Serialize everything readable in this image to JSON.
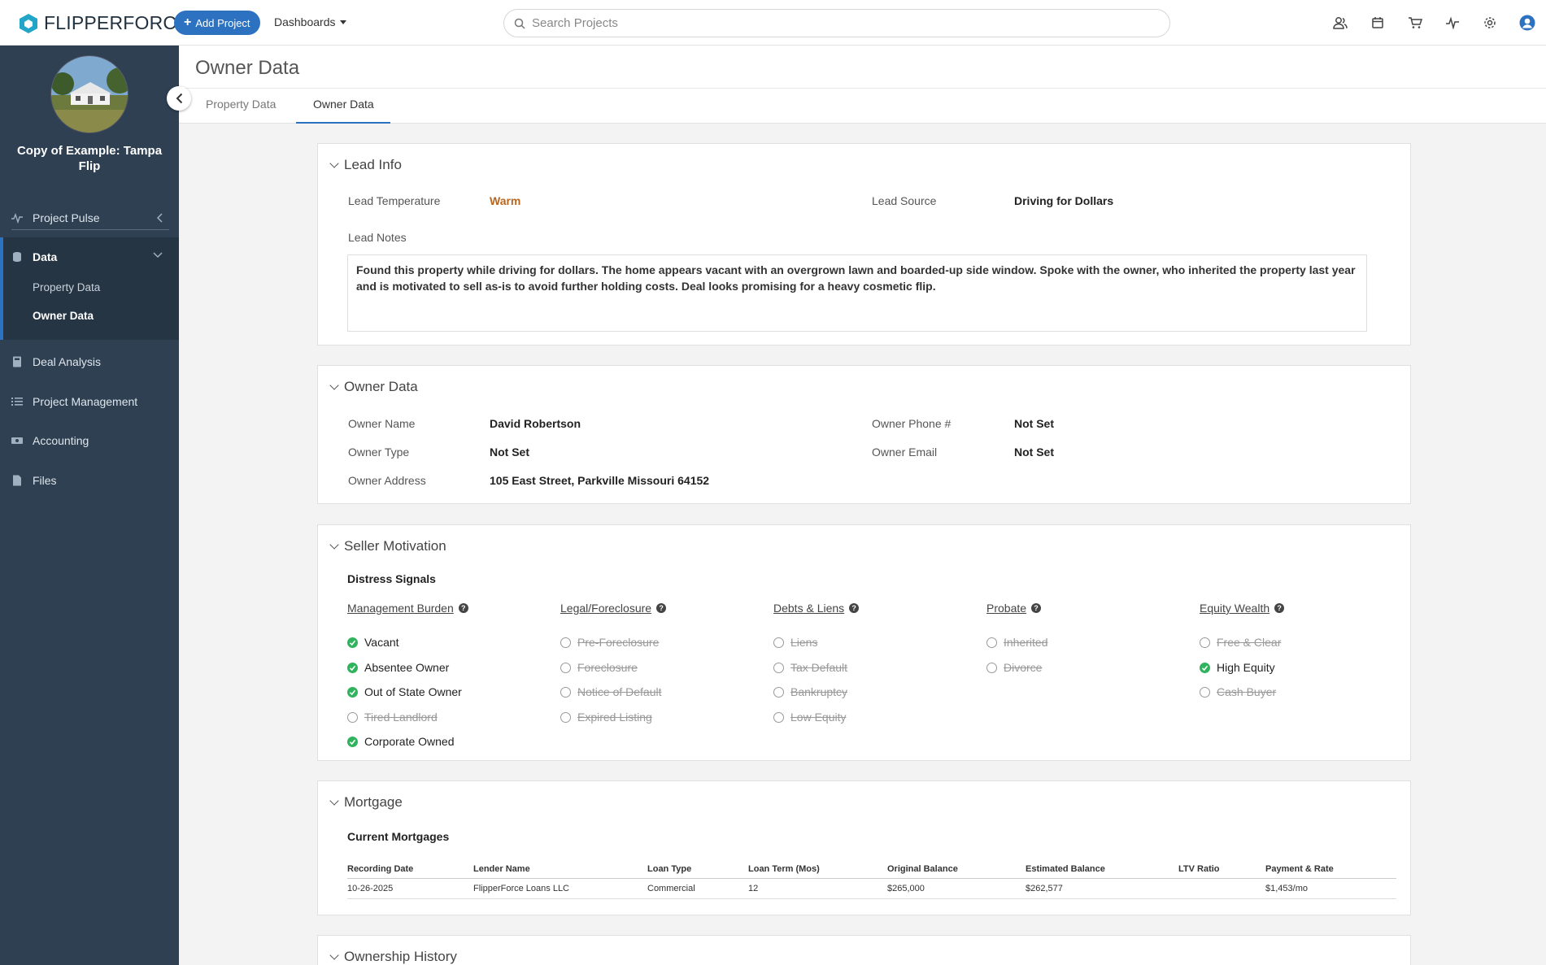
{
  "app": {
    "brand": "FLIPPERFORCE",
    "add_project": "Add Project",
    "dashboards": "Dashboards",
    "search_placeholder": "Search Projects",
    "top_icons": [
      "users-icon",
      "calendar-icon",
      "cart-icon",
      "pulse-icon",
      "settings-icon",
      "profile-avatar-icon"
    ]
  },
  "sidebar": {
    "project_name": "Copy of Example: Tampa Flip",
    "project_pulse": "Project Pulse",
    "data": "Data",
    "property_data": "Property Data",
    "owner_data": "Owner Data",
    "deal_analysis": "Deal Analysis",
    "project_management": "Project Management",
    "accounting": "Accounting",
    "files": "Files"
  },
  "header": {
    "title": "Owner Data",
    "tabs": [
      "Property Data",
      "Owner Data"
    ]
  },
  "lead_info": {
    "title": "Lead Info",
    "temp_label": "Lead Temperature",
    "temp_value": "Warm",
    "source_label": "Lead Source",
    "source_value": "Driving for Dollars",
    "notes_label": "Lead Notes",
    "notes": "Found this property while driving for dollars. The home appears vacant with an overgrown lawn and boarded-up side window. Spoke with the owner, who inherited the property last year and is motivated to sell as-is to avoid further holding costs. Deal looks promising for a heavy cosmetic flip."
  },
  "owner": {
    "title": "Owner Data",
    "name_label": "Owner Name",
    "name_value": "David Robertson",
    "type_label": "Owner Type",
    "type_value": "Not Set",
    "address_label": "Owner Address",
    "address_value": "105 East Street, Parkville Missouri 64152",
    "phone_label": "Owner Phone #",
    "phone_value": "Not Set",
    "email_label": "Owner Email",
    "email_value": "Not Set"
  },
  "seller": {
    "title": "Seller Motivation",
    "subhead": "Distress Signals",
    "categories": [
      {
        "name": "Management Burden",
        "signals": [
          {
            "label": "Vacant",
            "on": true
          },
          {
            "label": "Absentee Owner",
            "on": true
          },
          {
            "label": "Out of State Owner",
            "on": true
          },
          {
            "label": "Tired Landlord",
            "on": false
          },
          {
            "label": "Corporate Owned",
            "on": true
          }
        ]
      },
      {
        "name": "Legal/Foreclosure",
        "signals": [
          {
            "label": "Pre-Foreclosure",
            "on": false
          },
          {
            "label": "Foreclosure",
            "on": false
          },
          {
            "label": "Notice of Default",
            "on": false
          },
          {
            "label": "Expired Listing",
            "on": false
          }
        ]
      },
      {
        "name": "Debts & Liens",
        "signals": [
          {
            "label": "Liens",
            "on": false
          },
          {
            "label": "Tax Default",
            "on": false
          },
          {
            "label": "Bankruptcy",
            "on": false
          },
          {
            "label": "Low Equity",
            "on": false
          }
        ]
      },
      {
        "name": "Probate",
        "signals": [
          {
            "label": "Inherited",
            "on": false
          },
          {
            "label": "Divorce",
            "on": false
          }
        ]
      },
      {
        "name": "Equity Wealth",
        "signals": [
          {
            "label": "Free & Clear",
            "on": false
          },
          {
            "label": "High Equity",
            "on": true
          },
          {
            "label": "Cash Buyer",
            "on": false
          }
        ]
      }
    ]
  },
  "mortgage": {
    "title": "Mortgage",
    "subhead": "Current Mortgages",
    "columns": [
      "Recording Date",
      "Lender Name",
      "Loan Type",
      "Loan Term (Mos)",
      "Original Balance",
      "Estimated Balance",
      "LTV Ratio",
      "Payment & Rate"
    ],
    "rows": [
      [
        "10-26-2025",
        "FlipperForce Loans LLC",
        "Commercial",
        "12",
        "$265,000",
        "$262,577",
        "",
        "$1,453/mo"
      ]
    ]
  },
  "ownership": {
    "title": "Ownership History"
  },
  "colors": {
    "accent": "#2d72c0",
    "sidebar": "#2e4052",
    "warm": "#b8651f",
    "check": "#2fb35c"
  }
}
